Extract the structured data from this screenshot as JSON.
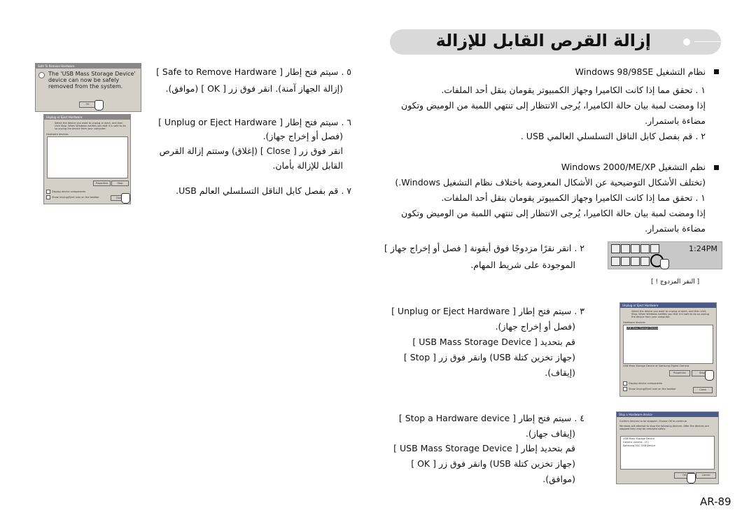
{
  "title": "إزالة القرص القابل للإزالة",
  "right": {
    "win98_heading": "نظام التشغيل Windows 98/98SE",
    "win98_lines": [
      "١ . تحقق مما إذا كانت الكاميرا وجهاز الكمبيوتر يقومان بنقل أحد الملفات.",
      "إذا ومضت لمبة بيان حالة الكاميرا، يُرجى الانتظار إلى تنتهي اللمبة من الوميض وتكون",
      "مضاءة باستمرار.",
      "٢ . قم بفصل كابل الناقل التسلسلي العالمي USB ."
    ],
    "win2000_heading": "نظم التشغيل Windows 2000/ME/XP",
    "win2000_lines": [
      "(تختلف الأشكال التوضيحية عن الأشكال المعروضة باختلاف نظام التشغيل Windows.)",
      "١ . تحقق مما إذا كانت الكاميرا وجهاز الكمبيوتر يقومان بنقل أحد الملفات.",
      "إذا ومضت لمبة بيان حالة الكاميرا، يُرجى الانتظار إلى تنتهي اللمبة من الوميض وتكون",
      "مضاءة باستمرار."
    ],
    "step2": [
      "٢ . انقر نقرًا مزدوجًا فوق أيقونة [ فصل أو إخراج جهاز ]",
      "الموجودة على شريط المهام."
    ],
    "tray_time": "1:24PM",
    "tray_caption": "[ النقر المزدوج ! ]",
    "step3": [
      "٣ . سيتم فتح إطار [ Unplug or Eject Hardware ]",
      "(فصل أو إخراج جهاز).",
      "قم بتحديد [ USB Mass Storage Device ]",
      "(جهاز تخزين كتلة USB) وانقر فوق زر [ Stop ]",
      "(إيقاف)."
    ],
    "step4": [
      "٤ . سيتم فتح إطار [ Stop a Hardware device ]",
      "(إيقاف جهاز).",
      "قم بتحديد إطار [ USB Mass Storage Device ]",
      "(جهاز تخزين كتلة USB) وانقر فوق زر [ OK ]",
      "(موافق)."
    ]
  },
  "left": {
    "step5": [
      "٥ . سيتم فتح إطار [ Safe to Remove Hardware ]",
      "(إزالة الجهاز آمنة). انقر فوق زر [ OK ] (موافق)."
    ],
    "step6": [
      "٦ . سيتم فتح إطار [ Unplug or Eject Hardware ]",
      "(فصل أو إخراج جهاز).",
      "انقر فوق زر [ Close ] (إغلاق) وستتم إزالة القرص",
      "القابل للإزالة بأمان."
    ],
    "step7": "٧ . قم بفصل كابل الناقل التسلسلي العالم USB."
  },
  "dialogs": {
    "safe": {
      "title": "Safe To Remove Hardware",
      "message": "The 'USB Mass Storage Device' device can now be safely removed from the system.",
      "ok": "OK"
    },
    "unplug": {
      "title": "Unplug or Eject Hardware",
      "message": "Select the device you want to unplug or eject, and then click Stop. When Windows notifies you that it is safe to do so unplug the device from your computer.",
      "hw_label": "Hardware devices:",
      "device": "USB Mass Storage Device",
      "device_desc": "USB Mass Storage Device at Samsung Digital Camera",
      "properties": "Properties",
      "stop": "Stop",
      "close": "Close",
      "display_components": "Display device components",
      "show_icon": "Show Unplug/Eject icon on the taskbar"
    },
    "stop": {
      "title": "Stop a Hardware device",
      "confirm": "Confirm devices to be stopped. Choose OK to continue.",
      "message": "Windows will attempt to stop the following devices. After the devices are stopped they may be removed safely.",
      "items": [
        "USB Mass Storage Device",
        "Generic volume - (F:)",
        "Samsung DSC USB Device"
      ],
      "ok": "OK",
      "cancel": "Cancel"
    }
  },
  "page_number": "AR-89"
}
